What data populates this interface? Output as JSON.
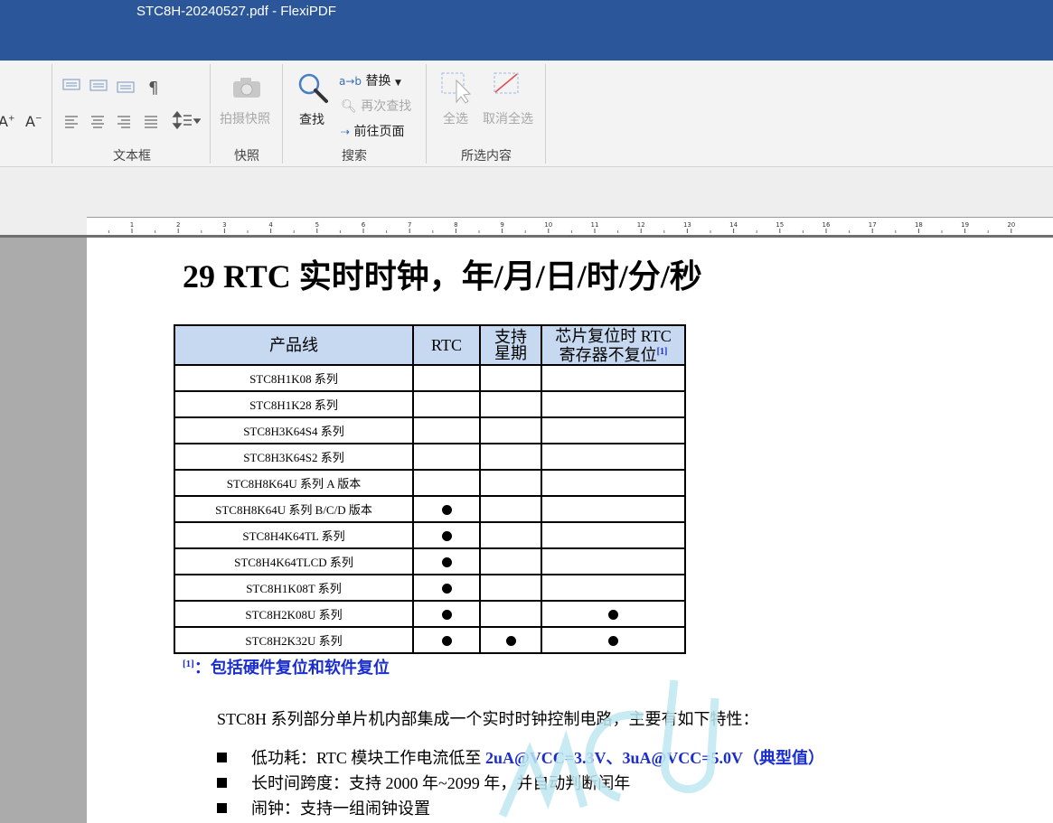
{
  "window": {
    "title": "STC8H-20240527.pdf - FlexiPDF"
  },
  "ribbon": {
    "font_size_up": "A",
    "font_size_down": "A",
    "groups": {
      "textbox": {
        "label": "文本框"
      },
      "snapshot": {
        "label": "快照",
        "take_snapshot": "拍摄快照"
      },
      "search": {
        "label": "搜索",
        "find": "查找",
        "replace": "替换",
        "find_again": "再次查找",
        "goto_page": "前往页面"
      },
      "selection": {
        "label": "所选内容",
        "select_all": "全选",
        "deselect_all": "取消全选"
      }
    }
  },
  "ruler": {
    "numbers": [
      "1",
      "2",
      "3",
      "4",
      "5",
      "6",
      "7",
      "8",
      "9",
      "10",
      "11",
      "12",
      "13",
      "14",
      "15",
      "16",
      "17",
      "18",
      "19",
      "20"
    ]
  },
  "document": {
    "heading": "29 RTC 实时时钟，年/月/日/时/分/秒",
    "table": {
      "headers": {
        "product_line": "产品线",
        "rtc": "RTC",
        "weekday_line1": "支持",
        "weekday_line2": "星期",
        "reset_line1": "芯片复位时 RTC",
        "reset_line2": "寄存器不复位",
        "reset_note": "[1]"
      },
      "rows": [
        {
          "name": "STC8H1K08 系列",
          "rtc": false,
          "weekday": false,
          "no_reset": false
        },
        {
          "name": "STC8H1K28 系列",
          "rtc": false,
          "weekday": false,
          "no_reset": false
        },
        {
          "name": "STC8H3K64S4 系列",
          "rtc": false,
          "weekday": false,
          "no_reset": false
        },
        {
          "name": "STC8H3K64S2 系列",
          "rtc": false,
          "weekday": false,
          "no_reset": false
        },
        {
          "name": "STC8H8K64U 系列 A 版本",
          "rtc": false,
          "weekday": false,
          "no_reset": false
        },
        {
          "name": "STC8H8K64U 系列 B/C/D 版本",
          "rtc": true,
          "weekday": false,
          "no_reset": false
        },
        {
          "name": "STC8H4K64TL 系列",
          "rtc": true,
          "weekday": false,
          "no_reset": false
        },
        {
          "name": "STC8H4K64TLCD 系列",
          "rtc": true,
          "weekday": false,
          "no_reset": false
        },
        {
          "name": "STC8H1K08T 系列",
          "rtc": true,
          "weekday": false,
          "no_reset": false
        },
        {
          "name": "STC8H2K08U 系列",
          "rtc": true,
          "weekday": false,
          "no_reset": true
        },
        {
          "name": "STC8H2K32U 系列",
          "rtc": true,
          "weekday": true,
          "no_reset": true
        }
      ]
    },
    "note_marker": "[1]",
    "note_text": "：包括硬件复位和软件复位",
    "intro": "STC8H 系列部分单片机内部集成一个实时时钟控制电路，主要有如下特性：",
    "bullets": [
      {
        "prefix": "低功耗：RTC 模块工作电流低至 ",
        "highlight": "2uA@VCC=3.3V、3uA@VCC=5.0V（典型值）"
      },
      {
        "prefix": "长时间跨度：支持 2000 年~2099 年，并自动判断闰年",
        "highlight": ""
      },
      {
        "prefix": "闹钟：支持一组闹钟设置",
        "highlight": ""
      }
    ]
  }
}
